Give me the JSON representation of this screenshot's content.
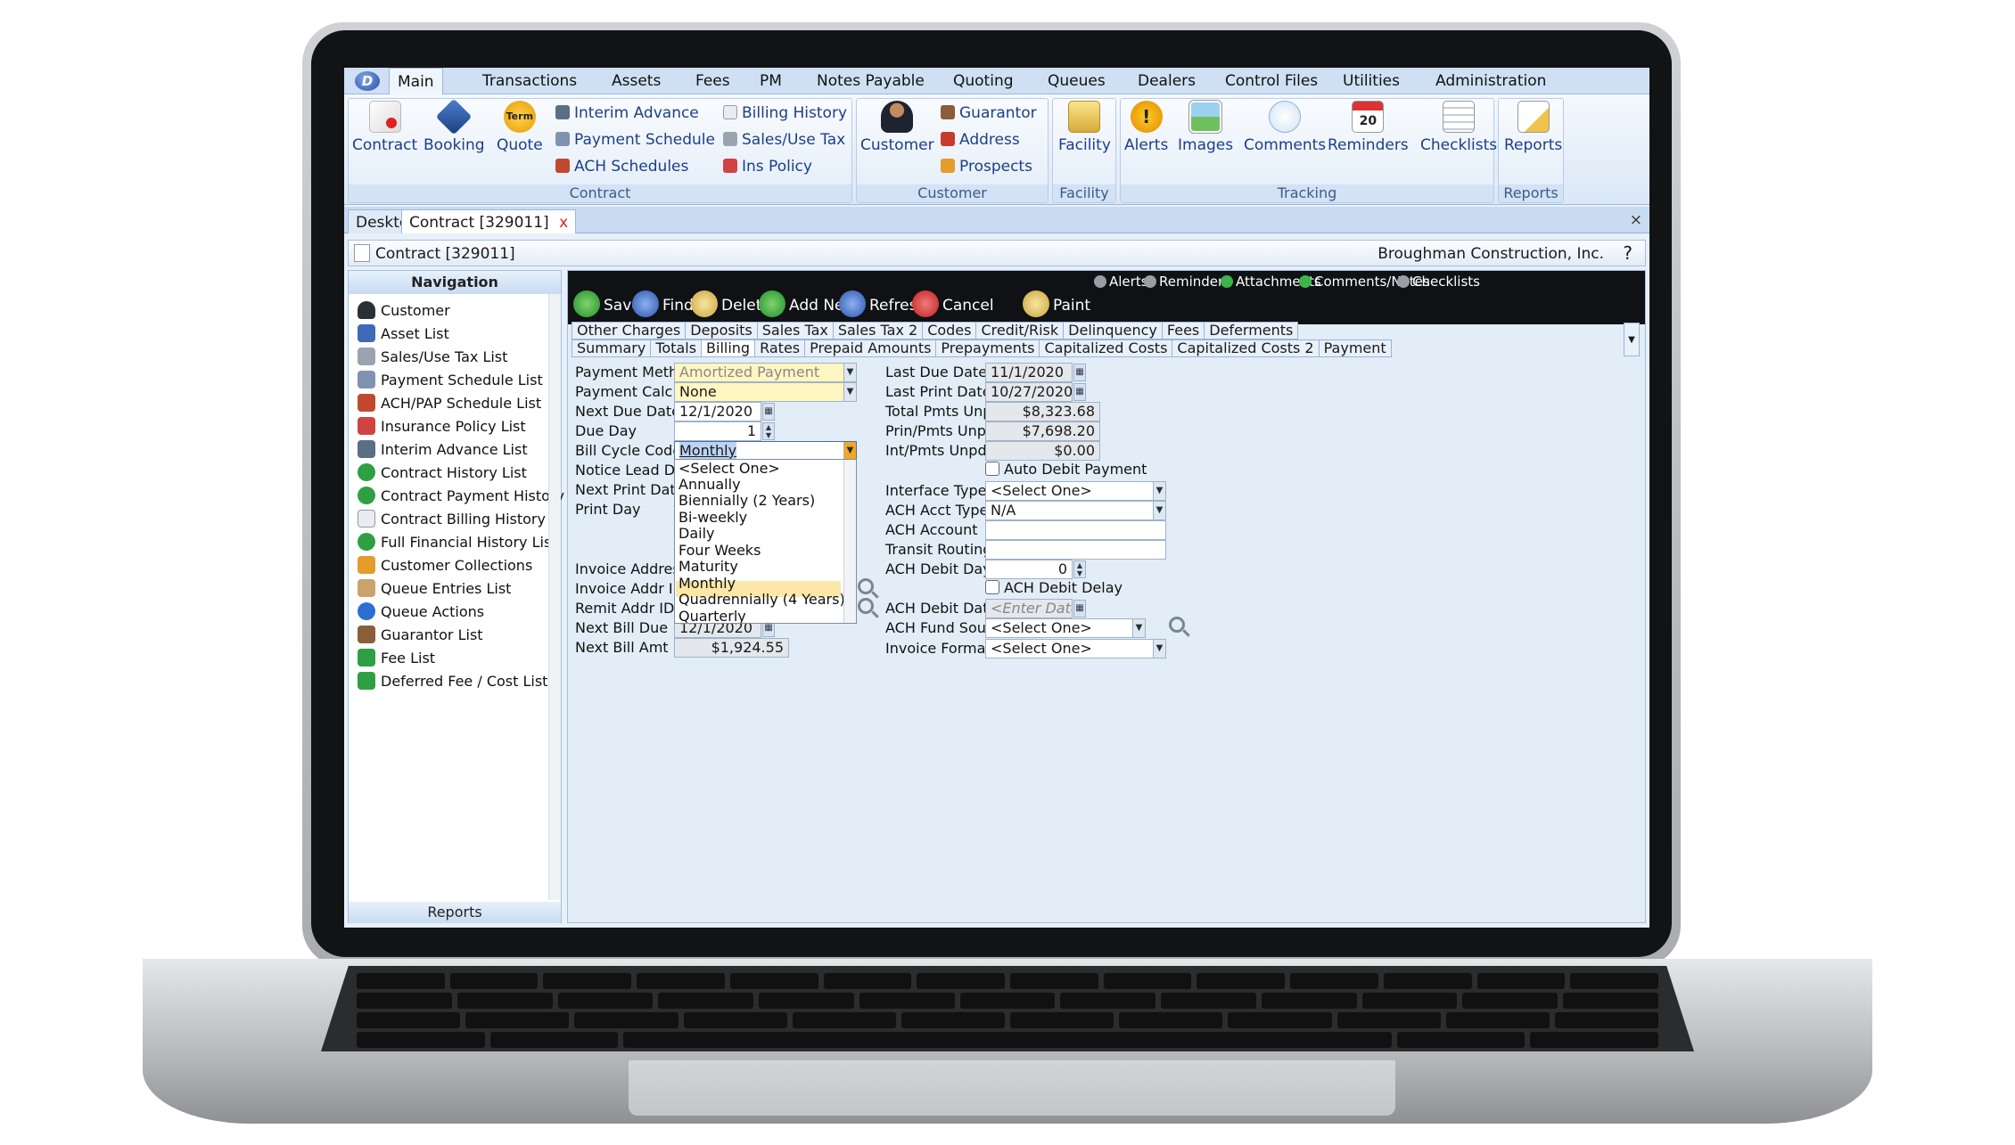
{
  "app": {
    "logo_letter": "D",
    "menu": [
      "Main",
      "Transactions",
      "Assets",
      "Fees",
      "PM",
      "Notes Payable",
      "Quoting",
      "Queues",
      "Dealers",
      "Control Files",
      "Utilities",
      "Administration"
    ]
  },
  "ribbon": {
    "contract_group": {
      "label": "Contract",
      "buttons": [
        "Contract",
        "Booking",
        "Quote"
      ],
      "quote_badge": "Term",
      "small_col1": [
        "Interim Advance",
        "Payment Schedule",
        "ACH Schedules"
      ],
      "small_col2": [
        "Billing History",
        "Sales/Use Tax",
        "Ins Policy"
      ]
    },
    "customer_group": {
      "label": "Customer",
      "button": "Customer",
      "small": [
        "Guarantor",
        "Address",
        "Prospects"
      ]
    },
    "facility_group": {
      "label": "Facility",
      "button": "Facility"
    },
    "tracking_group": {
      "label": "Tracking",
      "buttons": [
        "Alerts",
        "Images",
        "Comments",
        "Reminders",
        "Checklists"
      ],
      "reminders_badge": "20"
    },
    "reports_group": {
      "label": "Reports",
      "button": "Reports"
    }
  },
  "doc_tabs": {
    "desktop": "Desktop",
    "contract": "Contract [329011]",
    "close": "x",
    "close_all": "×"
  },
  "header": {
    "title": "Contract [329011]",
    "customer": "Broughman Construction, Inc.",
    "help": "?"
  },
  "navigation": {
    "title": "Navigation",
    "items": [
      "Customer",
      "Asset List",
      "Sales/Use Tax List",
      "Payment Schedule List",
      "ACH/PAP Schedule List",
      "Insurance Policy List",
      "Interim Advance List",
      "Contract History List",
      "Contract Payment History List",
      "Contract Billing History",
      "Full Financial History List",
      "Customer Collections",
      "Queue Entries List",
      "Queue Actions",
      "Guarantor List",
      "Fee List",
      "Deferred Fee / Cost List"
    ],
    "reports": "Reports"
  },
  "indicators": [
    "Alerts",
    "Reminders",
    "Attachments",
    "Comments/Notes",
    "Checklists"
  ],
  "toolbar": [
    "Save",
    "Find",
    "Delete",
    "Add New",
    "Refresh",
    "Cancel",
    "Paint"
  ],
  "tabs": {
    "row1": [
      "Other Charges",
      "Deposits",
      "Sales Tax",
      "Sales Tax 2",
      "Codes",
      "Credit/Risk",
      "Delinquency",
      "Fees",
      "Deferments"
    ],
    "row2": [
      "Summary",
      "Totals",
      "Billing",
      "Rates",
      "Prepaid Amounts",
      "Prepayments",
      "Capitalized Costs",
      "Capitalized Costs 2",
      "Payment"
    ],
    "active": "Billing"
  },
  "left_form": {
    "payment_method": {
      "label": "Payment Method",
      "value": "Amortized Payment"
    },
    "payment_calc": {
      "label": "Payment Calc",
      "value": "None"
    },
    "next_due_date": {
      "label": "Next Due Date",
      "value": "12/1/2020"
    },
    "due_day": {
      "label": "Due Day",
      "value": "1"
    },
    "bill_cycle_code": {
      "label": "Bill Cycle Code",
      "value": "Monthly"
    },
    "notice_lead_days": {
      "label": "Notice Lead Days"
    },
    "next_print_date": {
      "label": "Next Print Date"
    },
    "print_day": {
      "label": "Print Day"
    },
    "invoice_address": {
      "label": "Invoice Address"
    },
    "invoice_addr_id": {
      "label": "Invoice Addr ID"
    },
    "remit_addr_id": {
      "label": "Remit Addr ID"
    },
    "next_bill_due": {
      "label": "Next Bill Due",
      "value": "12/1/2020"
    },
    "next_bill_amt": {
      "label": "Next Bill Amt",
      "value": "$1,924.55"
    }
  },
  "bill_cycle_options": [
    "<Select One>",
    "Annually",
    "Biennially (2 Years)",
    "Bi-weekly",
    "Daily",
    "Four Weeks",
    "Maturity",
    "Monthly",
    "Quadrennially (4 Years)",
    "Quarterly"
  ],
  "right_form": {
    "last_due_date": {
      "label": "Last Due Date",
      "value": "11/1/2020"
    },
    "last_print_date": {
      "label": "Last Print Date",
      "value": "10/27/2020"
    },
    "total_pmts_unpd": {
      "label": "Total Pmts Unpd",
      "value": "$8,323.68"
    },
    "prin_pmts_unpd": {
      "label": "Prin/Pmts Unpd",
      "value": "$7,698.20"
    },
    "int_pmts_unpd": {
      "label": "Int/Pmts Unpd",
      "value": "$0.00"
    },
    "auto_debit": {
      "label": "Auto Debit Payment"
    },
    "interface_type": {
      "label": "Interface Type",
      "value": "<Select One>"
    },
    "ach_acct_type": {
      "label": "ACH Acct Type",
      "value": "N/A"
    },
    "ach_account": {
      "label": "ACH Account",
      "value": ""
    },
    "transit_routing": {
      "label": "Transit Routing",
      "value": ""
    },
    "ach_debit_days": {
      "label": "ACH Debit Days",
      "value": "0"
    },
    "ach_debit_delay": {
      "label": "ACH Debit Delay"
    },
    "ach_debit_date": {
      "label": "ACH Debit Date",
      "placeholder": "<Enter Date>"
    },
    "ach_fund_source": {
      "label": "ACH Fund Source",
      "value": "<Select One>"
    },
    "invoice_format": {
      "label": "Invoice Format",
      "value": "<Select One>"
    }
  },
  "colors": {
    "accent": "#1c3f86",
    "toolbar_bg": "#0f1114",
    "highlight": "#fbe7a6"
  }
}
